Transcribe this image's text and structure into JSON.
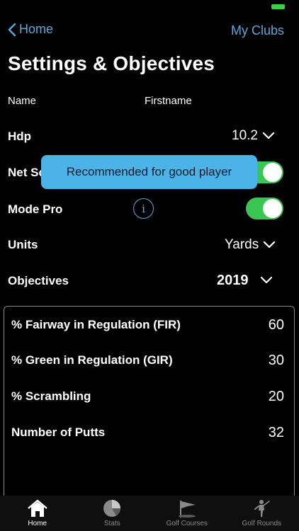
{
  "nav": {
    "back_label": "Home",
    "right_label": "My Clubs"
  },
  "page": {
    "title": "Settings & Objectives"
  },
  "profile": {
    "name_label": "Name",
    "firstname_label": "Firstname"
  },
  "settings": {
    "hdp_label": "Hdp",
    "hdp_value": "10.2",
    "net_score_label": "Net Sc",
    "net_score_on": true,
    "mode_pro_label": "Mode Pro",
    "mode_pro_on": true,
    "info_glyph": "i",
    "units_label": "Units",
    "units_value": "Yards",
    "objectives_label": "Objectives",
    "objectives_year": "2019"
  },
  "tooltip": {
    "text": "Recommended for good player"
  },
  "objectives": [
    {
      "label": "% Fairway in Regulation (FIR)",
      "value": "60"
    },
    {
      "label": "% Green in Regulation (GIR)",
      "value": "30"
    },
    {
      "label": "% Scrambling",
      "value": "20"
    },
    {
      "label": "Number of Putts",
      "value": "32"
    }
  ],
  "tabbar": {
    "active": "home",
    "tabs": [
      {
        "id": "home",
        "label": "Home",
        "icon": "house-icon"
      },
      {
        "id": "stats",
        "label": "Stats",
        "icon": "pie-chart-icon"
      },
      {
        "id": "courses",
        "label": "Golf Courses",
        "icon": "flag-icon"
      },
      {
        "id": "rounds",
        "label": "Golf Rounds",
        "icon": "golfer-icon"
      }
    ]
  },
  "colors": {
    "accent": "#5fa7d8",
    "toggle_on": "#3bc552",
    "tooltip_bg": "#4cb3e8",
    "battery": "#39d24a"
  }
}
